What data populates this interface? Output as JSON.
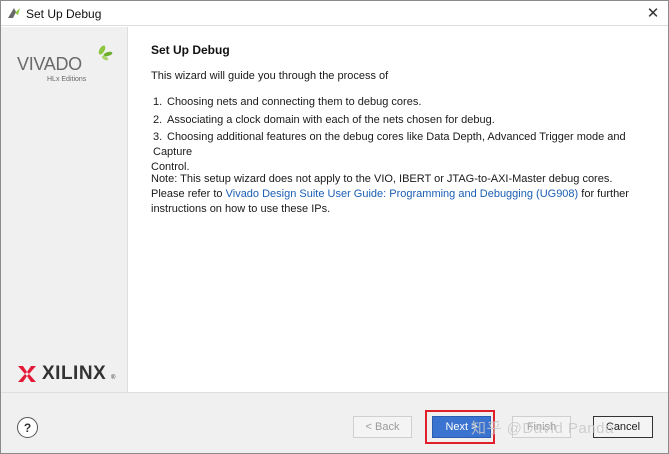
{
  "window": {
    "title": "Set Up Debug",
    "close_glyph": "✕"
  },
  "sidebar": {
    "vivado_word": "VIVADO",
    "vivado_sub": "HLx Editions",
    "xilinx_word": "XILINX",
    "xilinx_reg": "®"
  },
  "content": {
    "heading": "Set Up Debug",
    "intro": "This wizard will guide you through the process of",
    "steps": [
      {
        "num": "1.",
        "text": "Choosing nets and connecting them to debug cores."
      },
      {
        "num": "2.",
        "text": "Associating a clock domain with each of the nets chosen for debug."
      },
      {
        "num": "3.",
        "text": "Choosing additional features on the debug cores like Data Depth, Advanced Trigger mode and Capture",
        "cont": "Control."
      }
    ],
    "note_prefix": "Note: This setup wizard does not apply to the VIO, IBERT or JTAG-to-AXI-Master debug cores. Please refer to",
    "note_link": "Vivado Design Suite User Guide: Programming and Debugging (UG908)",
    "note_suffix": "for further instructions on how to use these IPs."
  },
  "footer": {
    "help_label": "?",
    "back_label": "< Back",
    "next_label": "Next >",
    "finish_label": "Finish",
    "cancel_label": "Cancel",
    "watermark": "知乎 @David Panda"
  },
  "colors": {
    "accent_blue": "#3b73d0",
    "link_blue": "#1a5fb4",
    "highlight_red": "#e0202a",
    "vivado_green": "#8dc63f"
  },
  "icons": {
    "app": "vivado-app-icon",
    "close": "close-icon",
    "help": "help-icon"
  }
}
